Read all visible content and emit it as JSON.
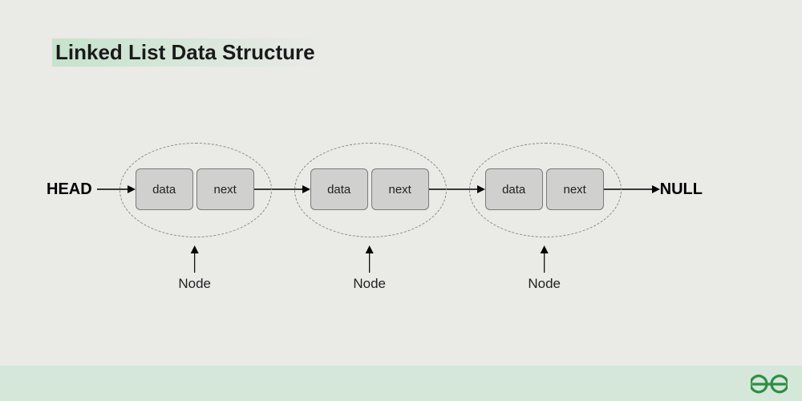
{
  "title": "Linked List Data Structure",
  "head_label": "HEAD",
  "null_label": "NULL",
  "node_label": "Node",
  "nodes": [
    {
      "data_label": "data",
      "next_label": "next"
    },
    {
      "data_label": "data",
      "next_label": "next"
    },
    {
      "data_label": "data",
      "next_label": "next"
    }
  ],
  "colors": {
    "background": "#eaeae7",
    "cell_fill": "#d0d0cf",
    "footer": "#d4e7d8",
    "logo": "#2f8d46"
  }
}
